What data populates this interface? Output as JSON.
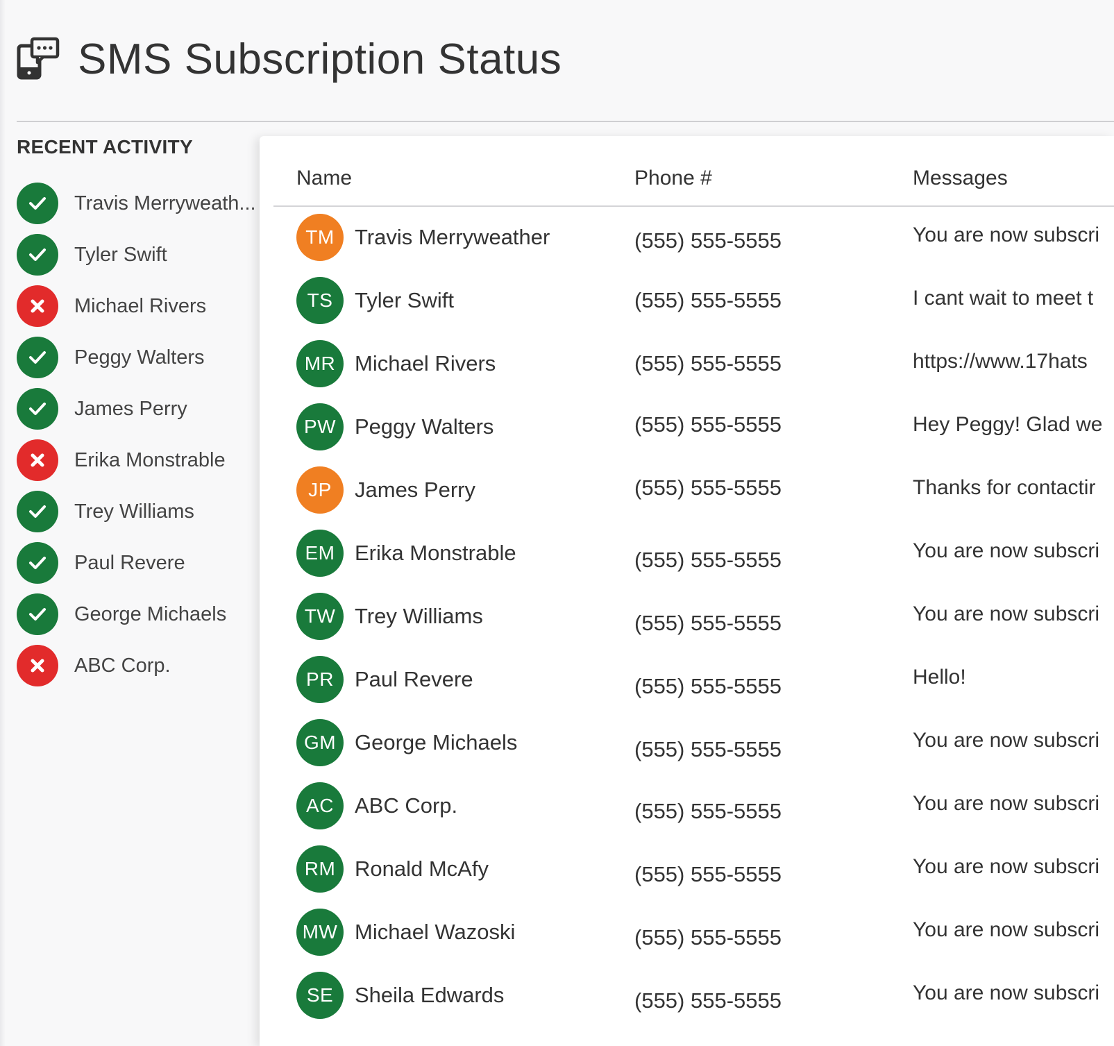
{
  "header": {
    "title": "SMS Subscription Status",
    "icon": "sms-phone-icon"
  },
  "recent_activity": {
    "title": "RECENT ACTIVITY",
    "items": [
      {
        "name": "Travis Merryweath...",
        "status": "success"
      },
      {
        "name": "Tyler Swift",
        "status": "success"
      },
      {
        "name": "Michael Rivers",
        "status": "failed"
      },
      {
        "name": "Peggy Walters",
        "status": "success"
      },
      {
        "name": "James Perry",
        "status": "success"
      },
      {
        "name": "Erika Monstrable",
        "status": "failed"
      },
      {
        "name": "Trey Williams",
        "status": "success"
      },
      {
        "name": "Paul Revere",
        "status": "success"
      },
      {
        "name": "George Michaels",
        "status": "success"
      },
      {
        "name": "ABC Corp.",
        "status": "failed"
      }
    ]
  },
  "table": {
    "columns": {
      "name": "Name",
      "phone": "Phone #",
      "messages": "Messages"
    },
    "rows": [
      {
        "initials": "TM",
        "name": "Travis Merryweather",
        "phone": "(555) 555-5555",
        "message": "You are now subscri",
        "avatar_color": "#f07f22"
      },
      {
        "initials": "TS",
        "name": "Tyler Swift",
        "phone": "(555) 555-5555",
        "message": "I cant wait to meet t",
        "avatar_color": "#197a3b"
      },
      {
        "initials": "MR",
        "name": "Michael Rivers",
        "phone": "(555) 555-5555",
        "message": "https://www.17hats",
        "avatar_color": "#197a3b"
      },
      {
        "initials": "PW",
        "name": "Peggy Walters",
        "phone": "(555) 555-5555",
        "message": "Hey Peggy! Glad we",
        "avatar_color": "#197a3b"
      },
      {
        "initials": "JP",
        "name": "James Perry",
        "phone": "(555) 555-5555",
        "message": "Thanks for contactir",
        "avatar_color": "#f07f22"
      },
      {
        "initials": "EM",
        "name": "Erika Monstrable",
        "phone": "(555) 555-5555",
        "message": "You are now subscri",
        "avatar_color": "#197a3b"
      },
      {
        "initials": "TW",
        "name": "Trey Williams",
        "phone": "(555) 555-5555",
        "message": "You are now subscri",
        "avatar_color": "#197a3b"
      },
      {
        "initials": "PR",
        "name": "Paul Revere",
        "phone": "(555) 555-5555",
        "message": "Hello!",
        "avatar_color": "#197a3b"
      },
      {
        "initials": "GM",
        "name": "George Michaels",
        "phone": "(555) 555-5555",
        "message": "You are now subscri",
        "avatar_color": "#197a3b"
      },
      {
        "initials": "AC",
        "name": "ABC Corp.",
        "phone": "(555) 555-5555",
        "message": "You are now subscri",
        "avatar_color": "#197a3b"
      },
      {
        "initials": "RM",
        "name": "Ronald McAfy",
        "phone": "(555) 555-5555",
        "message": "You are now subscri",
        "avatar_color": "#197a3b"
      },
      {
        "initials": "MW",
        "name": "Michael Wazoski",
        "phone": "(555) 555-5555",
        "message": "You are now subscri",
        "avatar_color": "#197a3b"
      },
      {
        "initials": "SE",
        "name": "Sheila Edwards",
        "phone": "(555) 555-5555",
        "message": "You are now subscri",
        "avatar_color": "#197a3b"
      }
    ]
  },
  "colors": {
    "success": "#197a3b",
    "failed": "#e22b2b",
    "accent_orange": "#f07f22"
  }
}
